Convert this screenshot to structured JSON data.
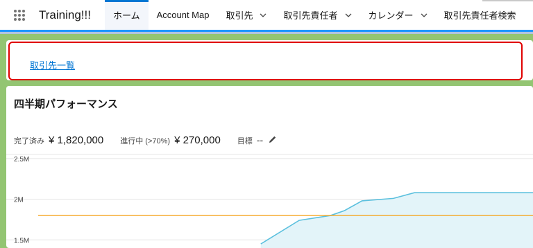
{
  "nav": {
    "app_name": "Training!!!",
    "tabs": [
      {
        "label": "ホーム",
        "active": true,
        "dropdown": false
      },
      {
        "label": "Account Map",
        "active": false,
        "dropdown": false
      },
      {
        "label": "取引先",
        "active": false,
        "dropdown": true
      },
      {
        "label": "取引先責任者",
        "active": false,
        "dropdown": true
      },
      {
        "label": "カレンダー",
        "active": false,
        "dropdown": true
      },
      {
        "label": "取引先責任者検索",
        "active": false,
        "dropdown": false
      }
    ]
  },
  "list_card": {
    "link_label": "取引先一覧"
  },
  "performance": {
    "title": "四半期パフォーマンス",
    "closed_label": "完了済み",
    "closed_value": "¥ 1,820,000",
    "open_label": "進行中 (>70%)",
    "open_value": "¥ 270,000",
    "goal_label": "目標",
    "goal_value": "--"
  },
  "chart_data": {
    "type": "area",
    "y_ticks": [
      "2.5M",
      "2M",
      "1.5M"
    ],
    "ylim": [
      1.4,
      2.55
    ],
    "xlim": [
      0,
      14
    ],
    "goal_line": 1.8,
    "series": [
      {
        "x": [
          6.2,
          7.3,
          8.2,
          8.6,
          9.1,
          10.0,
          10.6,
          14
        ],
        "y": [
          1.45,
          1.74,
          1.8,
          1.86,
          1.98,
          2.01,
          2.08,
          2.08
        ]
      }
    ],
    "colors": {
      "line": "#5bc0de",
      "fill": "#e3f4f9",
      "goal": "#f5a623"
    }
  },
  "colors": {
    "accent": "#0176d3",
    "workspace": "#93c572",
    "highlight": "#e00000"
  }
}
